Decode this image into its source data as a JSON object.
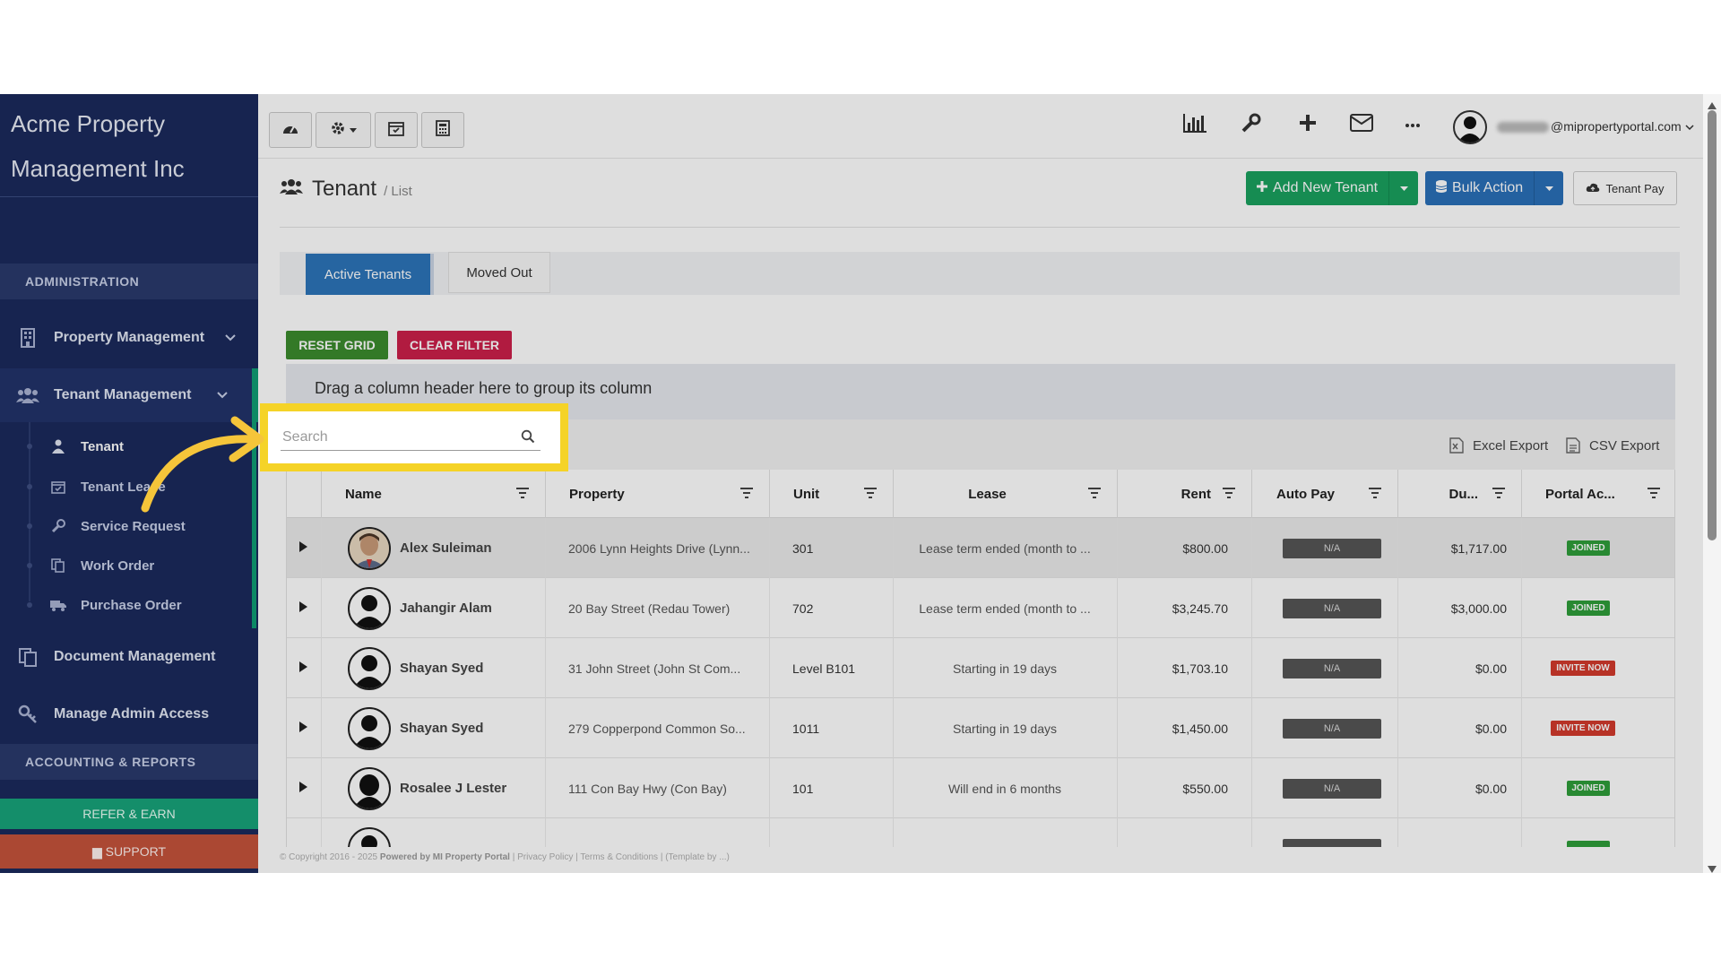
{
  "brand": {
    "line1": "Acme Property",
    "line2": "Management Inc"
  },
  "sidebar": {
    "section_admin": "ADMINISTRATION",
    "property_management": "Property Management",
    "tenant_management": "Tenant Management",
    "sub_items": [
      "Tenant",
      "Tenant Lease",
      "Service Request",
      "Work Order",
      "Purchase Order"
    ],
    "document_management": "Document Management",
    "manage_admin_access": "Manage Admin Access",
    "section_accounting": "ACCOUNTING & REPORTS",
    "refer": "REFER & EARN",
    "support": "SUPPORT"
  },
  "topbar": {
    "user_email_suffix": "@mipropertyportal.com"
  },
  "page": {
    "title": "Tenant",
    "subtitle": "/ List",
    "add_new": "Add New Tenant",
    "bulk_action": "Bulk Action",
    "tenant_pay": "Tenant Pay"
  },
  "tabs": {
    "active": "Active Tenants",
    "moved_out": "Moved Out"
  },
  "grid_actions": {
    "reset": "RESET GRID",
    "clear": "CLEAR FILTER"
  },
  "group_panel": "Drag a column header here to group its column",
  "search": {
    "placeholder": "Search",
    "value": ""
  },
  "exports": {
    "excel": "Excel Export",
    "csv": "CSV Export"
  },
  "columns": [
    "Name",
    "Property",
    "Unit",
    "Lease",
    "Rent",
    "Auto Pay",
    "Du...",
    "Portal Ac..."
  ],
  "rows": [
    {
      "name": "Alex Suleiman",
      "property": "2006 Lynn Heights Drive (Lynn...",
      "unit": "301",
      "lease": "Lease term ended (month to ...",
      "rent": "$800.00",
      "autopay": "N/A",
      "due": "$1,717.00",
      "portal": "JOINED"
    },
    {
      "name": "Jahangir Alam",
      "property": "20 Bay Street (Redau Tower)",
      "unit": "702",
      "lease": "Lease term ended (month to ...",
      "rent": "$3,245.70",
      "autopay": "N/A",
      "due": "$3,000.00",
      "portal": "JOINED"
    },
    {
      "name": "Shayan Syed",
      "property": "31 John Street (John St Com...",
      "unit": "Level B101",
      "lease": "Starting in 19 days",
      "rent": "$1,703.10",
      "autopay": "N/A",
      "due": "$0.00",
      "portal": "INVITE NOW"
    },
    {
      "name": "Shayan Syed",
      "property": "279 Copperpond Common So...",
      "unit": "1011",
      "lease": "Starting in 19 days",
      "rent": "$1,450.00",
      "autopay": "N/A",
      "due": "$0.00",
      "portal": "INVITE NOW"
    },
    {
      "name": "Rosalee J Lester",
      "property": "111 Con Bay Hwy (Con Bay)",
      "unit": "101",
      "lease": "Will end in 6 months",
      "rent": "$550.00",
      "autopay": "N/A",
      "due": "$0.00",
      "portal": "JOINED"
    }
  ],
  "footer": {
    "copyright": "© Copyright 2016 - 2025",
    "powered": "Powered by MI Property Portal",
    "privacy": "| Privacy Policy |",
    "terms": "Terms & Conditions",
    "template": "| (Template by ...)"
  },
  "colors": {
    "sidebar": "#1b2a5c",
    "accent_green": "#1aa15f",
    "accent_blue": "#2a70b8",
    "highlight": "#f5d327",
    "arrow": "#f5c53a"
  }
}
